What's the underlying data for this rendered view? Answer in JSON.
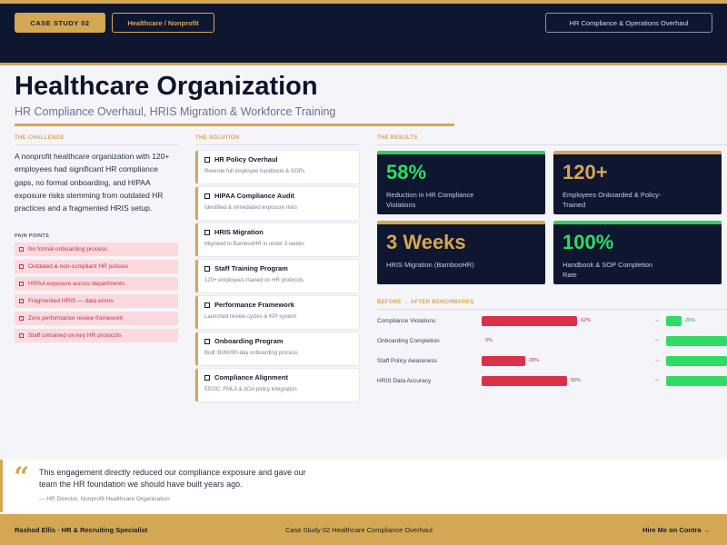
{
  "header": {
    "case_label": "CASE STUDY  02",
    "sector": "Healthcare / Nonprofit",
    "project": "HR Compliance & Operations Overhaul"
  },
  "title": "Healthcare Organization",
  "subtitle": "HR Compliance Overhaul, HRIS Migration & Workforce Training",
  "sections": {
    "challenge": "THE CHALLENGE",
    "solution": "THE SOLUTION",
    "results": "THE RESULTS",
    "pain_points": "PAIN POINTS",
    "benchmarks": "BEFORE → AFTER BENCHMARKS"
  },
  "challenge_text": "A nonprofit healthcare organization with 120+ employees had significant HR compliance gaps, no formal onboarding, and HIPAA exposure risks stemming from outdated HR practices and a fragmented HRIS setup.",
  "pain_points": [
    "No formal onboarding process",
    "Outdated & non-compliant HR policies",
    "HIPAA exposure across departments",
    "Fragmented HRIS — data errors",
    "Zero performance review framework",
    "Staff untrained on key HR protocols"
  ],
  "solutions": [
    {
      "title": "HR Policy Overhaul",
      "desc": "Rewrote full employee handbook & SOPs"
    },
    {
      "title": "HIPAA Compliance Audit",
      "desc": "Identified & remediated exposure risks"
    },
    {
      "title": "HRIS Migration",
      "desc": "Migrated to BambooHR in under 3 weeks"
    },
    {
      "title": "Staff Training Program",
      "desc": "120+ employees trained on HR protocols"
    },
    {
      "title": "Performance Framework",
      "desc": "Launched review cycles & KPI system"
    },
    {
      "title": "Onboarding Program",
      "desc": "Built 30/60/90-day onboarding process"
    },
    {
      "title": "Compliance Alignment",
      "desc": "EEOC, FMLA & ADA policy integration"
    }
  ],
  "results": [
    {
      "value": "58%",
      "label": "Reduction in HR Compliance Violations",
      "accent": "green"
    },
    {
      "value": "120+",
      "label": "Employees Onboarded & Policy-Trained",
      "accent": "gold"
    },
    {
      "value": "3 Weeks",
      "label": "HRIS Migration (BambooHR)",
      "accent": "gold"
    },
    {
      "value": "100%",
      "label": "Handbook & SOP Completion Rate",
      "accent": "green"
    }
  ],
  "benchmarks": [
    {
      "name": "Compliance Violations",
      "before": 62,
      "before_label": "62%",
      "after": 26,
      "after_label": "26%"
    },
    {
      "name": "Onboarding Completion",
      "before": 0,
      "before_label": "0%",
      "after": 100,
      "after_label": ""
    },
    {
      "name": "Staff Policy Awareness",
      "before": 28,
      "before_label": "28%",
      "after": 100,
      "after_label": ""
    },
    {
      "name": "HRIS Data Accuracy",
      "before": 55,
      "before_label": "55%",
      "after": 100,
      "after_label": ""
    }
  ],
  "quote": {
    "mark": "“",
    "text": "This engagement directly reduced our compliance exposure and gave our team the HR foundation we should have built years ago.",
    "attribution": "— HR Director, Nonprofit Healthcare Organization"
  },
  "footer": {
    "left": "Rashod Ellis  ·  HR & Recruiting Specialist",
    "mid": "Case Study 02     Healthcare Compliance Overhaul",
    "right": "Hire Me on Contra  →"
  },
  "colors": {
    "navy": "#0f1730",
    "gold": "#d4a754",
    "green": "#2fdc63",
    "red": "#dc2f4a"
  }
}
